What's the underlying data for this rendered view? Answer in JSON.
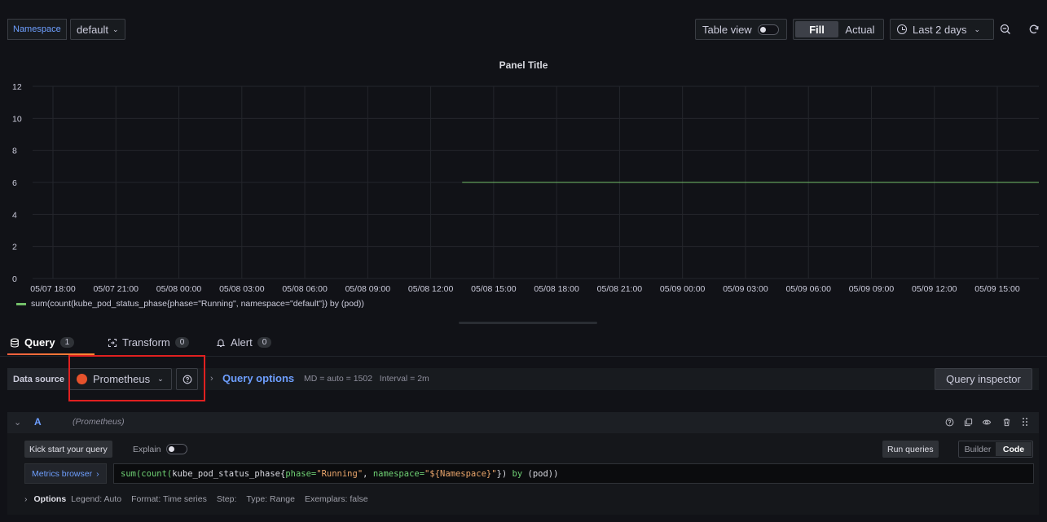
{
  "toolbar": {
    "namespace_label": "Namespace",
    "namespace_value": "default",
    "table_view_label": "Table view",
    "fill_label": "Fill",
    "actual_label": "Actual",
    "time_range": "Last 2 days"
  },
  "panel": {
    "title": "Panel Title",
    "legend_label": "sum(count(kube_pod_status_phase{phase=\"Running\", namespace=\"default\"}) by (pod))"
  },
  "chart_data": {
    "type": "line",
    "y_ticks": [
      "0",
      "2",
      "4",
      "6",
      "8",
      "10",
      "12"
    ],
    "ylim": [
      0,
      12
    ],
    "x_ticks": [
      "05/07 18:00",
      "05/07 21:00",
      "05/08 00:00",
      "05/08 03:00",
      "05/08 06:00",
      "05/08 09:00",
      "05/08 12:00",
      "05/08 15:00",
      "05/08 18:00",
      "05/08 21:00",
      "05/09 00:00",
      "05/09 03:00",
      "05/09 06:00",
      "05/09 09:00",
      "05/09 12:00",
      "05/09 15:00"
    ],
    "series": [
      {
        "name": "sum(count(kube_pod_status_phase{phase=\"Running\", namespace=\"default\"}) by (pod))",
        "color": "#73bf69",
        "x": [
          "05/08 13:30",
          "05/09 17:00"
        ],
        "values": [
          6,
          6
        ]
      }
    ],
    "grid": true,
    "legend_position": "bottom-left"
  },
  "tabs": [
    {
      "label": "Query",
      "count": "1"
    },
    {
      "label": "Transform",
      "count": "0"
    },
    {
      "label": "Alert",
      "count": "0"
    }
  ],
  "datasource": {
    "label": "Data source",
    "name": "Prometheus",
    "query_options_label": "Query options",
    "query_options_summary": "MD = auto = 1502   Interval = 2m",
    "inspector_label": "Query inspector"
  },
  "query_a": {
    "letter": "A",
    "datasource": "(Prometheus)",
    "kickstart_label": "Kick start your query",
    "explain_label": "Explain",
    "run_queries_label": "Run queries",
    "builder_label": "Builder",
    "code_label": "Code",
    "metrics_browser_label": "Metrics browser",
    "expr": {
      "p1": "sum(",
      "p2": "count(",
      "p3": "kube_pod_status_phase{",
      "p4": "phase=",
      "p5": "\"Running\"",
      "p6": ", ",
      "p7": "namespace=",
      "p8": "\"${Namespace}\"",
      "p9": "}) ",
      "p10": "by",
      "p11": " (pod))"
    },
    "options_label": "Options",
    "options": [
      "Legend: Auto",
      "Format: Time series",
      "Step:",
      "Type: Range",
      "Exemplars: false"
    ]
  }
}
